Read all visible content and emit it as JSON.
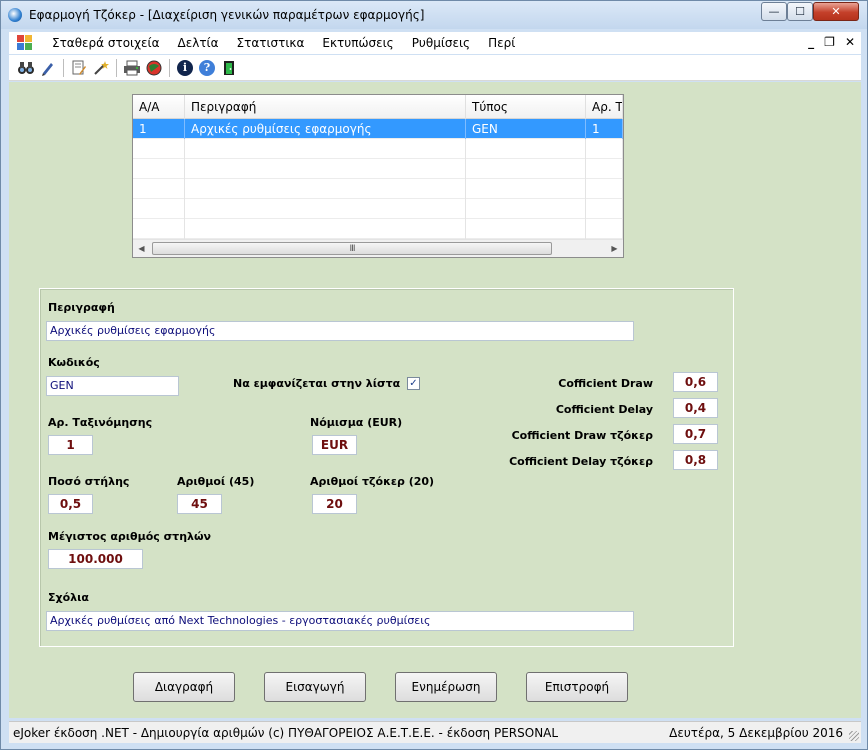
{
  "window": {
    "title": "Εφαρμογή Τζόκερ - [Διαχείριση γενικών παραμέτρων εφαρμογής]",
    "min_glyph": "—",
    "max_glyph": "☐",
    "close_glyph": "✕"
  },
  "menu": {
    "items": [
      "Σταθερά στοιχεία",
      "Δελτία",
      "Στατιστικα",
      "Εκτυπώσεις",
      "Ρυθμίσεις",
      "Περί"
    ],
    "mdi_min": "_",
    "mdi_restore": "❐",
    "mdi_close": "✕"
  },
  "toolbar": {
    "icons": [
      "binoculars-icon",
      "pen-icon",
      "document-edit-icon",
      "wand-icon",
      "printer-icon",
      "globe-icon",
      "info-icon",
      "help-icon",
      "exit-door-icon"
    ],
    "info_glyph": "i",
    "help_glyph": "?"
  },
  "grid": {
    "columns": [
      "Α/Α",
      "Περιγραφή",
      "Τύπος",
      "Αρ. Τα"
    ],
    "rows": [
      [
        "1",
        "Αρχικές ρυθμίσεις εφαρμογής",
        "GEN",
        "1"
      ]
    ],
    "empty_rows": 6,
    "scroll_left": "◀",
    "scroll_right": "▶",
    "scroll_grip": "III"
  },
  "form": {
    "description_label": "Περιγραφή",
    "description_value": "Αρχικές ρυθμίσεις εφαρμογής",
    "code_label": "Κωδικός",
    "code_value": "GEN",
    "show_in_list_label": "Να εμφανίζεται στην λίστα",
    "show_in_list_checked": true,
    "check_glyph": "✓",
    "sort_label": "Αρ. Ταξινόμησης",
    "sort_value": "1",
    "currency_label": "Νόμισμα (EUR)",
    "currency_value": "EUR",
    "column_amount_label": "Ποσό στήλης",
    "column_amount_value": "0,5",
    "numbers_label": "Αριθμοί (45)",
    "numbers_value": "45",
    "joker_numbers_label": "Αριθμοί τζόκερ (20)",
    "joker_numbers_value": "20",
    "max_columns_label": "Μέγιστος αριθμός στηλών",
    "max_columns_value": "100.000",
    "comments_label": "Σχόλια",
    "comments_value": "Αρχικές ρυθμίσεις από Next Technologies - εργοστασιακές ρυθμίσεις",
    "coeff_draw_label": "Cofficient Draw",
    "coeff_draw_value": "0,6",
    "coeff_delay_label": "Cofficient Delay",
    "coeff_delay_value": "0,4",
    "coeff_draw_joker_label": "Cofficient Draw τζόκερ",
    "coeff_draw_joker_value": "0,7",
    "coeff_delay_joker_label": "Cofficient Delay τζόκερ",
    "coeff_delay_joker_value": "0,8"
  },
  "buttons": {
    "delete": "Διαγραφή",
    "insert": "Εισαγωγή",
    "update": "Ενημέρωση",
    "back": "Επιστροφή"
  },
  "status": {
    "left": "eJoker έκδοση .NET  - Δημιουργία αριθμών  (c) ΠΥΘΑΓΟΡΕΙΟΣ  Α.Ε.Τ.Ε.Ε.  - έκδοση PERSONAL",
    "right": "Δευτέρα, 5 Δεκεμβρίου 2016"
  },
  "colors": {
    "client_bg": "#d4e2c6",
    "selection": "#3399ff",
    "number_text": "#6e0e0e",
    "input_text": "#0d0d7a"
  }
}
